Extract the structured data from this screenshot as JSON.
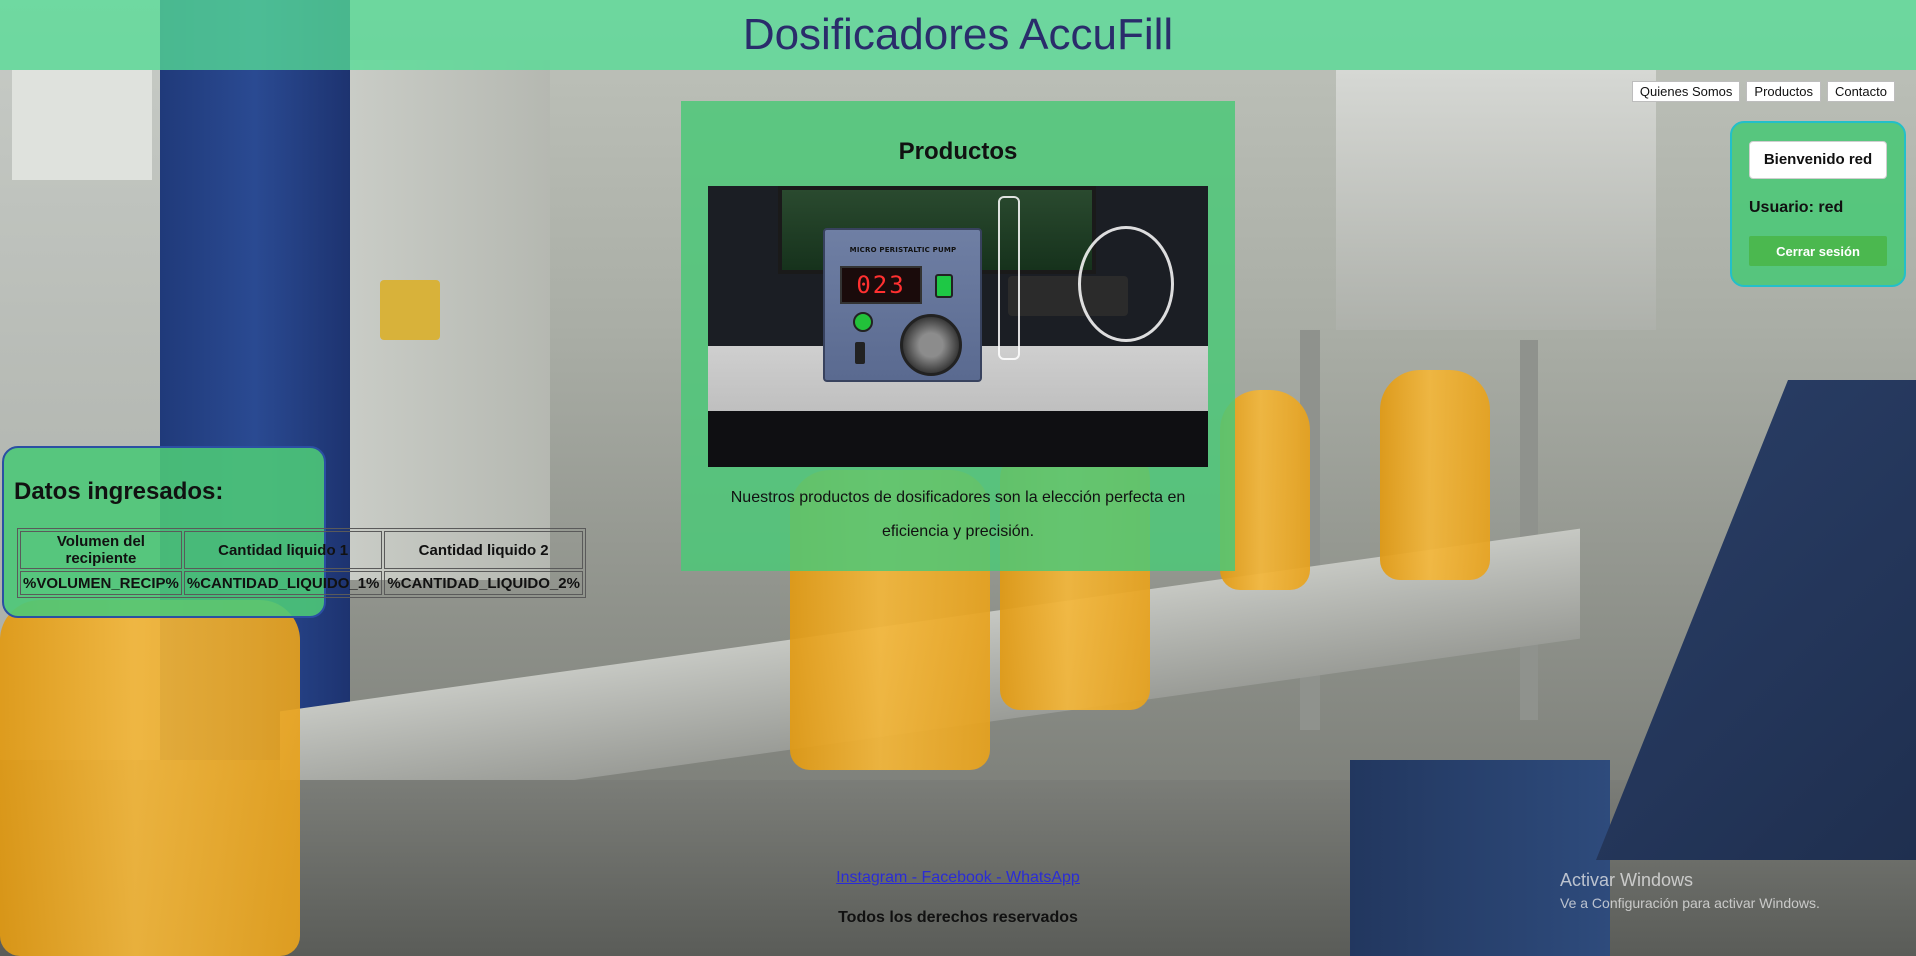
{
  "header": {
    "title": "Dosificadores AccuFill"
  },
  "nav": {
    "items": [
      {
        "label": "Quienes Somos"
      },
      {
        "label": "Productos"
      },
      {
        "label": "Contacto"
      }
    ]
  },
  "productos": {
    "title": "Productos",
    "photo": {
      "display_value": "023",
      "device_label": "MICRO PERISTALTIC PUMP"
    },
    "description": "Nuestros productos de dosificadores son la elección perfecta en eficiencia y precisión."
  },
  "user_panel": {
    "welcome": "Bienvenido red",
    "user_line": "Usuario: red",
    "logout_label": "Cerrar sesión"
  },
  "datos": {
    "title": "Datos ingresados:",
    "columns": [
      "Volumen del recipiente",
      "Cantidad liquido 1",
      "Cantidad liquido 2"
    ],
    "row": [
      "%VOLUMEN_RECIP%",
      "%CANTIDAD_LIQUIDO_1%",
      "%CANTIDAD_LIQUIDO_2%"
    ]
  },
  "footer": {
    "links_text": "Instagram - Facebook - WhatsApp",
    "rights": "Todos los derechos reservados"
  },
  "watermark": {
    "title": "Activar Windows",
    "subtitle": "Ve a Configuración para activar Windows."
  },
  "colors": {
    "header_bg": "#56dc96",
    "panel_green": "#4cc878",
    "title_color": "#2a2c6b",
    "logout_green": "#4bb84f",
    "user_panel_border": "#23bfc9",
    "datos_border": "#2b4fa3",
    "link_color": "#2a2cd6"
  }
}
